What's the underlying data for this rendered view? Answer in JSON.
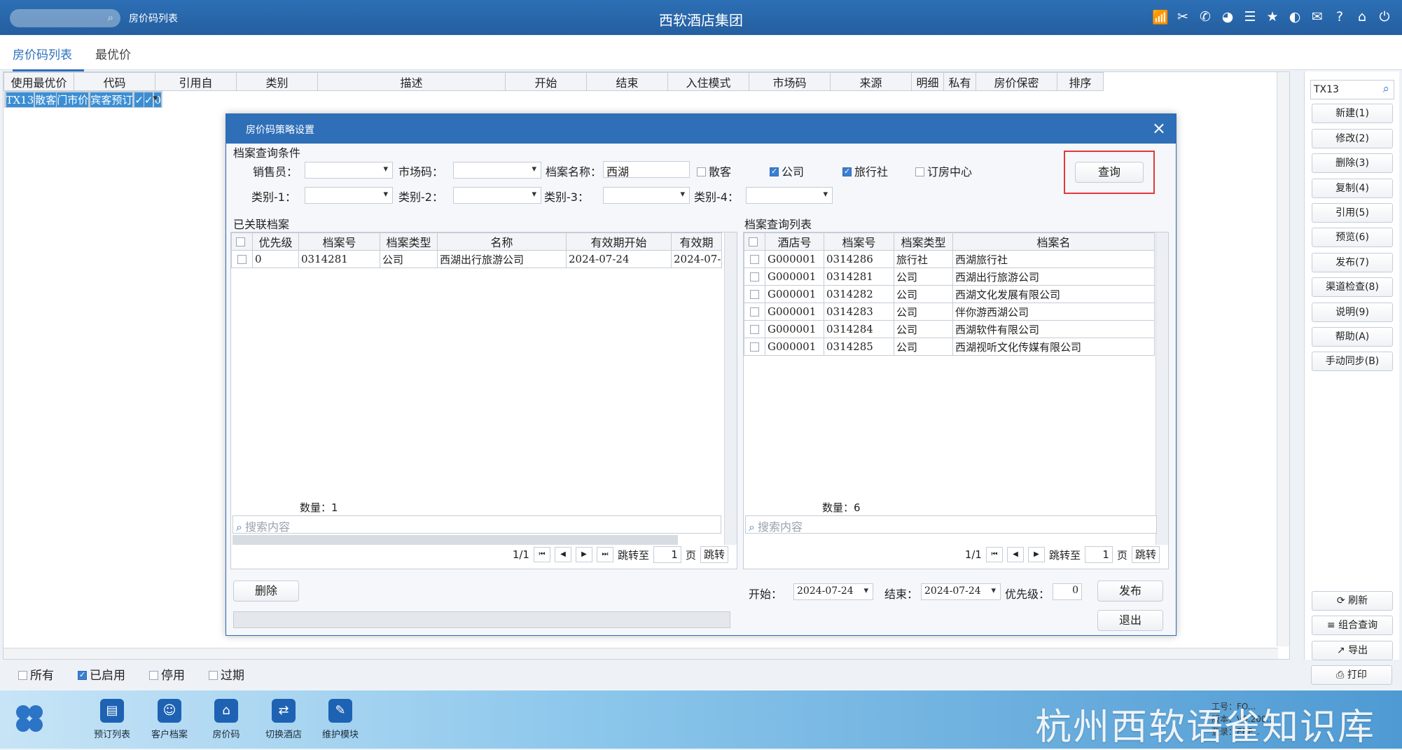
{
  "header": {
    "breadcrumb": "房价码列表",
    "app_title": "西软酒店集团",
    "icons": [
      "wifi-icon",
      "tools-icon",
      "phone-icon",
      "palette-icon",
      "menu-icon",
      "star-icon",
      "theme-icon",
      "mail-icon",
      "help-icon",
      "home-icon",
      "power-icon"
    ]
  },
  "tabs": [
    "房价码列表",
    "最优价"
  ],
  "main_table": {
    "columns": [
      "使用最优价",
      "代码",
      "引用自",
      "类别",
      "描述",
      "开始",
      "结束",
      "入住模式",
      "市场码",
      "来源",
      "明细",
      "私有",
      "房价保密",
      "排序"
    ],
    "rows": [
      [
        "",
        "TX13",
        "",
        "散客",
        "门市价",
        "",
        "",
        "宾客预订",
        "",
        "",
        "✓",
        "✓",
        "",
        "0"
      ]
    ]
  },
  "status_filters": [
    {
      "label": "所有",
      "checked": false
    },
    {
      "label": "已启用",
      "checked": true
    },
    {
      "label": "停用",
      "checked": false
    },
    {
      "label": "过期",
      "checked": false
    }
  ],
  "right_panel": {
    "search_value": "TX13",
    "buttons": [
      "新建(1)",
      "修改(2)",
      "删除(3)",
      "复制(4)",
      "引用(5)",
      "预览(6)",
      "发布(7)",
      "渠道检查(8)",
      "说明(9)",
      "帮助(A)",
      "手动同步(B)"
    ],
    "bottom_buttons": [
      "刷新",
      "组合查询",
      "导出",
      "打印"
    ]
  },
  "bottom_nav": {
    "items": [
      "预订列表",
      "客户档案",
      "房价码",
      "切换酒店",
      "维护模块"
    ],
    "version_lines": [
      "工号：FO...",
      "版本：V9.200...",
      "登录：ERP..."
    ],
    "watermark": "杭州西软语雀知识库"
  },
  "dialog": {
    "title": "房价码策略设置",
    "query_section": "档案查询条件",
    "labels": {
      "salesperson": "销售员：",
      "market_code": "市场码：",
      "archive_name": "档案名称：",
      "cat1": "类别-1：",
      "cat2": "类别-2：",
      "cat3": "类别-3：",
      "cat4": "类别-4："
    },
    "archive_name_value": "西湖",
    "type_checks": [
      {
        "label": "散客",
        "checked": false
      },
      {
        "label": "公司",
        "checked": true
      },
      {
        "label": "旅行社",
        "checked": true
      },
      {
        "label": "订房中心",
        "checked": false
      }
    ],
    "query_button": "查询",
    "linked": {
      "title": "已关联档案",
      "columns": [
        "优先级",
        "档案号",
        "档案类型",
        "名称",
        "有效期开始",
        "有效期"
      ],
      "rows": [
        [
          "0",
          "0314281",
          "公司",
          "西湖出行旅游公司",
          "2024-07-24",
          "2024-07-"
        ]
      ],
      "count": "数量：1",
      "search_placeholder": "搜索内容",
      "page": "1/1",
      "jump_to": "跳转至",
      "page_input": "1",
      "page_unit": "页",
      "jump_btn": "跳转"
    },
    "result": {
      "title": "档案查询列表",
      "columns": [
        "酒店号",
        "档案号",
        "档案类型",
        "档案名"
      ],
      "rows": [
        [
          "G000001",
          "0314286",
          "旅行社",
          "西湖旅行社"
        ],
        [
          "G000001",
          "0314281",
          "公司",
          "西湖出行旅游公司"
        ],
        [
          "G000001",
          "0314282",
          "公司",
          "西湖文化发展有限公司"
        ],
        [
          "G000001",
          "0314283",
          "公司",
          "伴你游西湖公司"
        ],
        [
          "G000001",
          "0314284",
          "公司",
          "西湖软件有限公司"
        ],
        [
          "G000001",
          "0314285",
          "公司",
          "西湖视听文化传媒有限公司"
        ]
      ],
      "count": "数量：6",
      "search_placeholder": "搜索内容",
      "page": "1/1",
      "jump_to": "跳转至",
      "page_input": "1",
      "page_unit": "页",
      "jump_btn": "跳转"
    },
    "delete_button": "删除",
    "start_label": "开始：",
    "start_value": "2024-07-24",
    "end_label": "结束：",
    "end_value": "2024-07-24",
    "priority_label": "优先级：",
    "priority_value": "0",
    "publish_button": "发布",
    "exit_button": "退出"
  }
}
